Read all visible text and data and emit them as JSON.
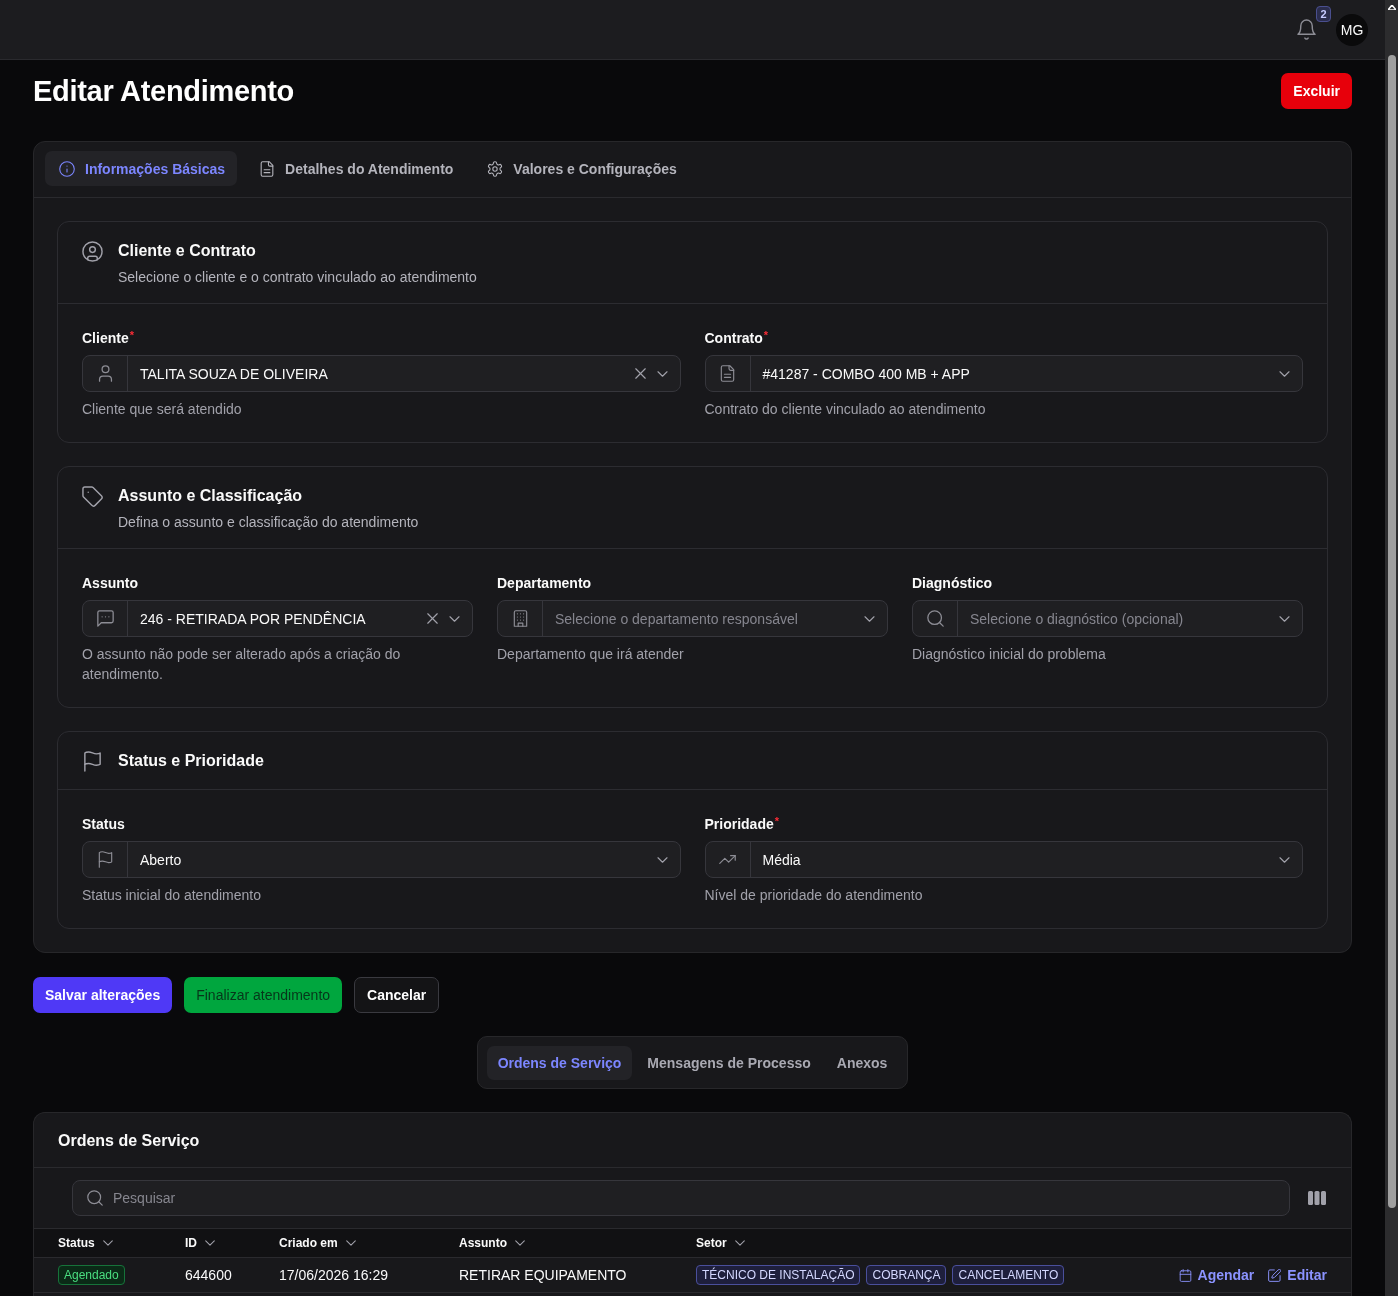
{
  "header": {
    "notifications": {
      "count": "2"
    },
    "avatar": {
      "initials": "MG"
    }
  },
  "page": {
    "title": "Editar Atendimento",
    "delete_button": "Excluir"
  },
  "tabs": [
    {
      "label": "Informações Básicas",
      "selected": true
    },
    {
      "label": "Detalhes do Atendimento",
      "selected": false
    },
    {
      "label": "Valores e Configurações",
      "selected": false
    }
  ],
  "sections": [
    {
      "title": "Cliente e Contrato",
      "subtitle": "Selecione o cliente e o contrato vinculado ao atendimento",
      "fields": [
        {
          "label": "Cliente",
          "required_mark": "*",
          "value": "TALITA SOUZA DE OLIVEIRA",
          "clearable": true,
          "help": "Cliente que será atendido"
        },
        {
          "label": "Contrato",
          "required_mark": "*",
          "value": "#41287 - COMBO 400 MB + APP",
          "clearable": false,
          "help": "Contrato do cliente vinculado ao atendimento"
        }
      ]
    },
    {
      "title": "Assunto e Classificação",
      "subtitle": "Defina o assunto e classificação do atendimento",
      "fields": [
        {
          "label": "Assunto",
          "value": "246 - RETIRADA POR PENDÊNCIA",
          "clearable": true,
          "help": "O assunto não pode ser alterado após a criação do atendimento."
        },
        {
          "label": "Departamento",
          "placeholder": "Selecione o departamento responsável",
          "clearable": false,
          "help": "Departamento que irá atender"
        },
        {
          "label": "Diagnóstico",
          "placeholder": "Selecione o diagnóstico (opcional)",
          "clearable": false,
          "help": "Diagnóstico inicial do problema"
        }
      ]
    },
    {
      "title": "Status e Prioridade",
      "fields": [
        {
          "label": "Status",
          "value": "Aberto",
          "clearable": false,
          "help": "Status inicial do atendimento"
        },
        {
          "label": "Prioridade",
          "required_mark": "*",
          "value": "Média",
          "clearable": false,
          "help": "Nível de prioridade do atendimento"
        }
      ]
    }
  ],
  "actions": [
    {
      "label": "Salvar alterações",
      "kind": "primary"
    },
    {
      "label": "Finalizar atendimento",
      "kind": "success"
    },
    {
      "label": "Cancelar",
      "kind": "outline"
    }
  ],
  "subtabs": [
    {
      "label": "Ordens de Serviço",
      "selected": true
    },
    {
      "label": "Mensagens de Processo",
      "selected": false
    },
    {
      "label": "Anexos",
      "selected": false
    }
  ],
  "orders": {
    "title": "Ordens de Serviço",
    "search": {
      "placeholder": "Pesquisar"
    },
    "table": {
      "columns": [
        "Status",
        "ID",
        "Criado em",
        "Assunto",
        "Setor"
      ],
      "rows": [
        {
          "status": "Agendado",
          "id": "644600",
          "created": "17/06/2026 16:29",
          "subject": "RETIRAR EQUIPAMENTO",
          "sectors": [
            "TÉCNICO DE INSTALAÇÃO",
            "COBRANÇA",
            "CANCELAMENTO"
          ],
          "actions": [
            "Agendar",
            "Editar"
          ]
        }
      ]
    }
  }
}
